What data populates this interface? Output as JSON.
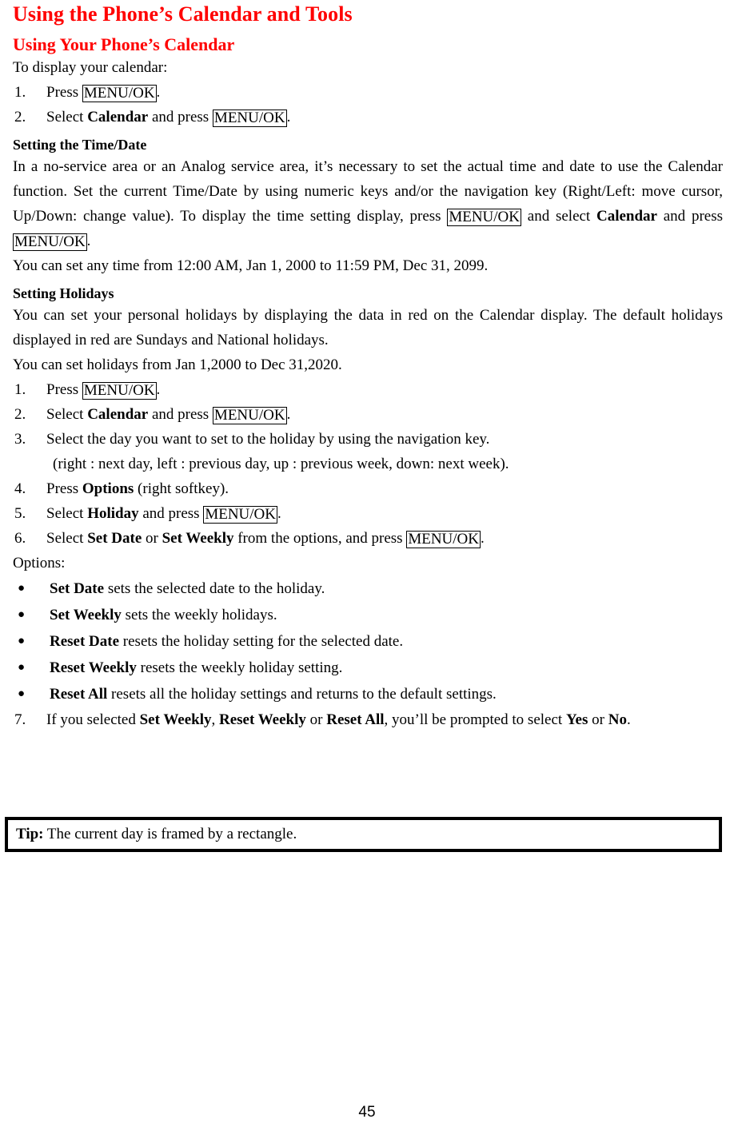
{
  "document": {
    "title": "Using the Phone’s Calendar and Tools",
    "page_number": "45"
  },
  "section": {
    "heading": "Using Your Phone’s Calendar",
    "intro": "To display your calendar:",
    "steps": [
      {
        "num": "1.",
        "pre": "Press ",
        "key": "MENU/OK",
        "post": "."
      },
      {
        "num": "2.",
        "pre": "Select ",
        "bold": "Calendar",
        "mid": " and press ",
        "key": "MENU/OK",
        "post": "."
      }
    ]
  },
  "time_date": {
    "heading": "Setting the Time/Date",
    "para_a": "In a no-service area or an Analog service area, it’s necessary to set the actual time and date to use the Calendar function. Set the current Time/Date by using numeric keys and/or the navigation key (Right/Left: move cursor, Up/Down: change value). To display the time setting display, press ",
    "key1": "MENU/OK",
    "para_b": " and select ",
    "bold1": "Calendar",
    "para_c": " and press ",
    "key2": "MENU/OK",
    "para_d": ".",
    "range_line": "You can set any time from 12:00 AM, Jan 1, 2000 to 11:59 PM, Dec 31, 2099."
  },
  "holidays": {
    "heading": "Setting Holidays",
    "para": "You can set your personal holidays by displaying the data in red on the Calendar display. The default holidays displayed in red are Sundays and National holidays.",
    "range_line": "You can set holidays from Jan 1,2000 to Dec 31,2020.",
    "steps": [
      {
        "num": "1.",
        "pre": "Press ",
        "key": "MENU/OK",
        "post": "."
      },
      {
        "num": "2.",
        "pre": "Select ",
        "bold": "Calendar",
        "mid": " and press ",
        "key": "MENU/OK",
        "post": "."
      },
      {
        "num": "3.",
        "pre": "Select the day you want to set to the holiday by using the navigation key.",
        "sub": "(right : next day, left : previous day, up : previous week, down: next week)."
      },
      {
        "num": "4.",
        "pre": "Press ",
        "bold": "Options",
        "post": " (right softkey)."
      },
      {
        "num": "5.",
        "pre": "Select ",
        "bold": "Holiday",
        "mid": " and press ",
        "key": "MENU/OK",
        "post": "."
      },
      {
        "num": "6.",
        "pre": "Select ",
        "bold": "Set Date",
        "mid": " or ",
        "bold2": "Set Weekly",
        "mid2": " from the options, and press ",
        "key": "MENU/OK",
        "post": "."
      }
    ],
    "options_label": "Options:",
    "options": [
      {
        "bullet": "●",
        "term": "Set Date",
        "desc": " sets the selected date to the holiday."
      },
      {
        "bullet": "●",
        "term": "Set Weekly",
        "desc": " sets the weekly holidays."
      },
      {
        "bullet": "●",
        "term": "Reset Date",
        "desc": " resets the holiday setting for the selected date."
      },
      {
        "bullet": "●",
        "term": "Reset Weekly",
        "desc": " resets the weekly holiday setting."
      },
      {
        "bullet": "●",
        "term": "Reset All",
        "desc": " resets all the holiday settings and returns to the default settings."
      }
    ],
    "step7": {
      "num": "7.",
      "pre": "If you selected ",
      "bold1": "Set Weekly",
      "mid1": ", ",
      "bold2": "Reset Weekly",
      "mid2": " or ",
      "bold3": "Reset All",
      "mid3": ", you’ll be prompted to select ",
      "bold4": "Yes",
      "mid4": " or ",
      "bold5": "No",
      "post": "."
    }
  },
  "tip": {
    "label": "Tip:",
    "text": " The current day is framed by a rectangle."
  },
  "colors": {
    "heading_red": "#ff0000",
    "body_black": "#000000",
    "page_background": "#ffffff"
  }
}
